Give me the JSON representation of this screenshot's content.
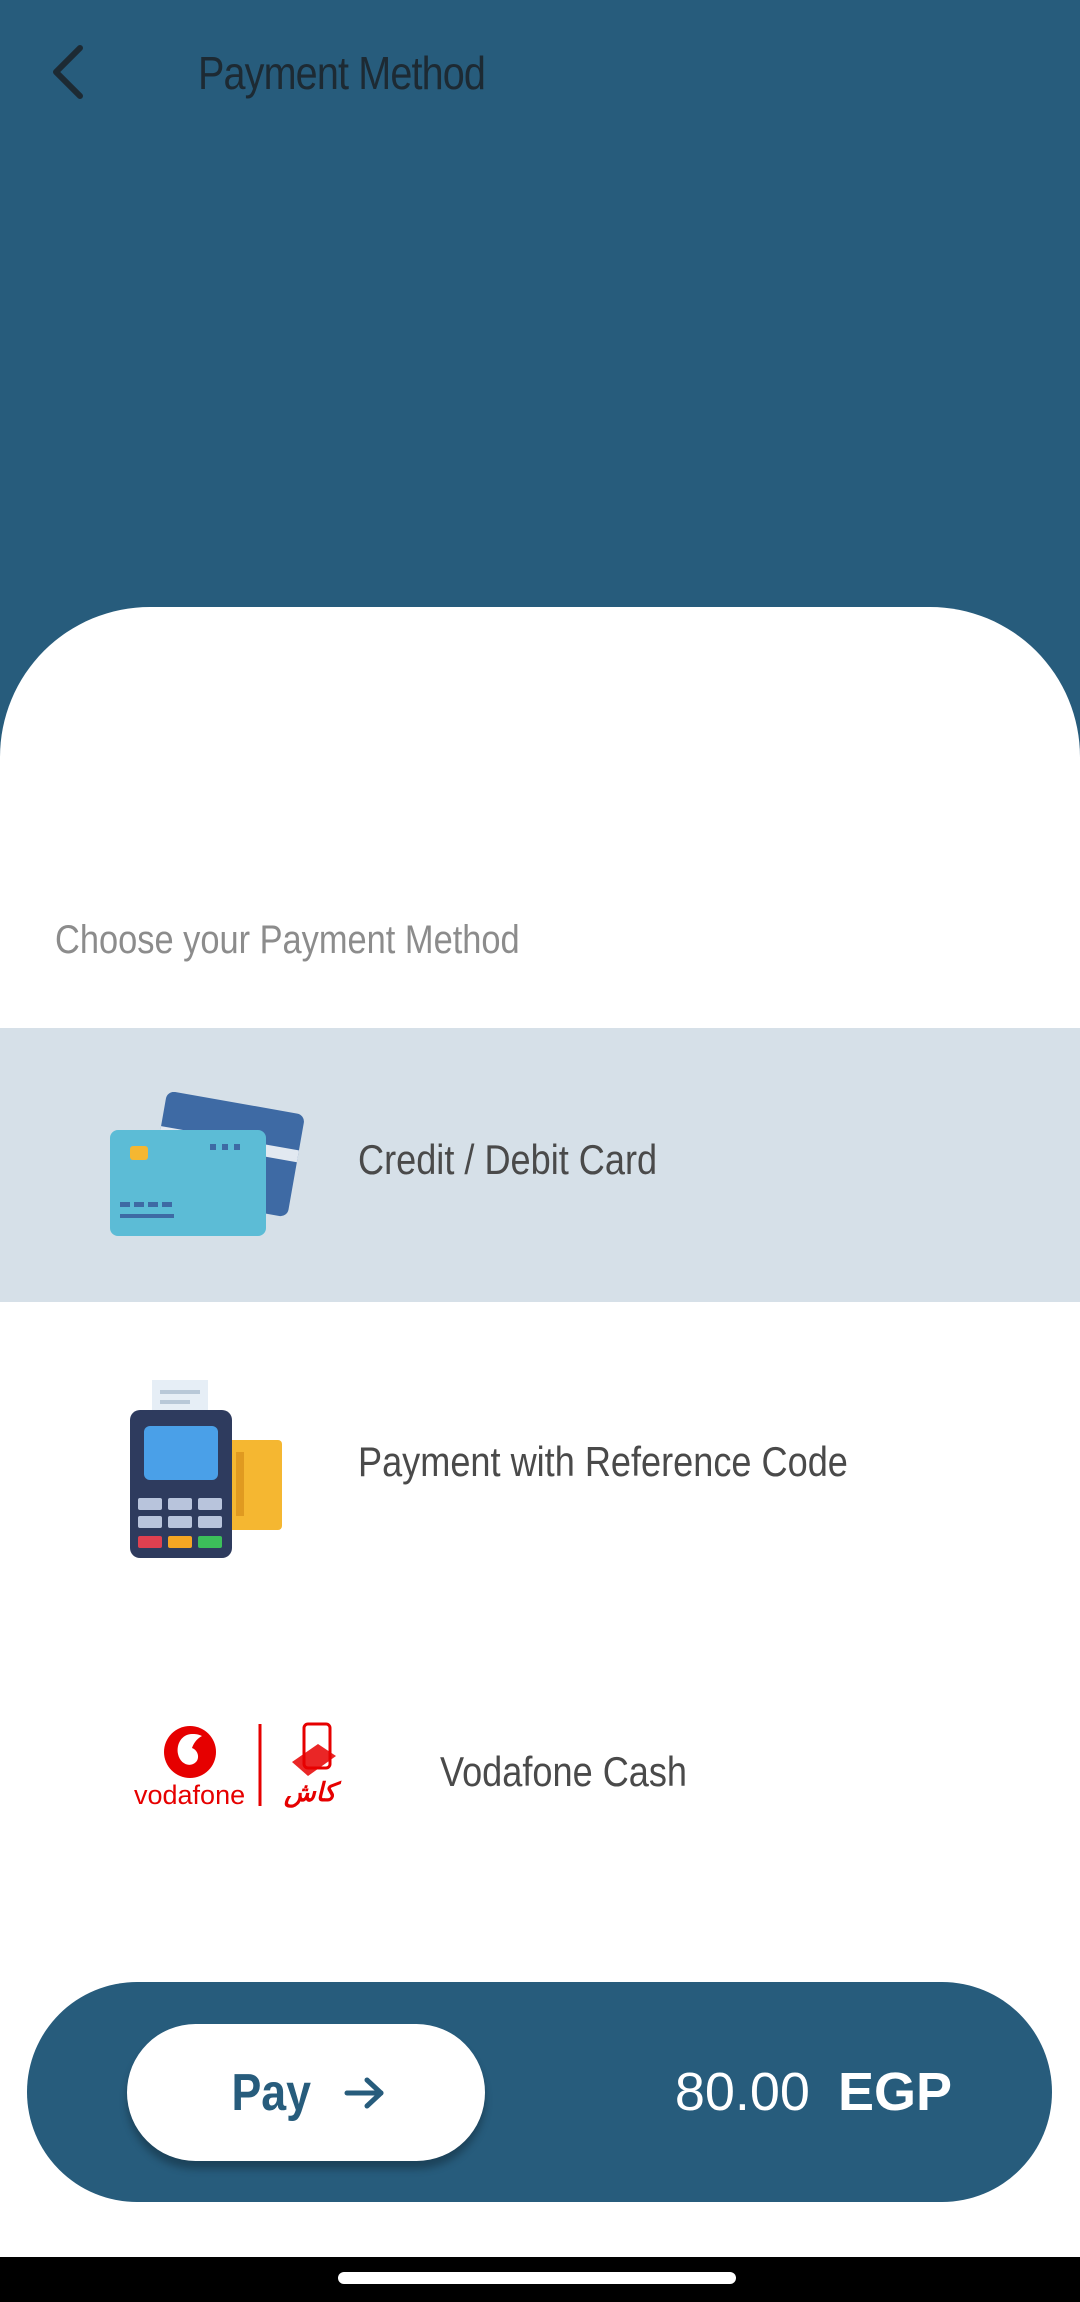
{
  "header": {
    "title": "Payment Method",
    "back_icon": "chevron-left-icon"
  },
  "section": {
    "label": "Choose your Payment Method"
  },
  "methods": [
    {
      "label": "Credit / Debit Card",
      "icon": "credit-card-icon",
      "selected": true
    },
    {
      "label": "Payment with Reference Code",
      "icon": "pos-terminal-icon",
      "selected": false
    },
    {
      "label": "Vodafone Cash",
      "icon": "vodafone-cash-logo",
      "selected": false
    }
  ],
  "logo": {
    "vodafone_text": "vodafone",
    "cash_text": "كاش"
  },
  "pay": {
    "label": "Pay",
    "arrow_icon": "arrow-right-icon",
    "amount": "80.00",
    "currency": "EGP"
  },
  "colors": {
    "primary": "#275c7c",
    "selected_row": "#d6e0e8",
    "vodafone_red": "#e60000"
  }
}
